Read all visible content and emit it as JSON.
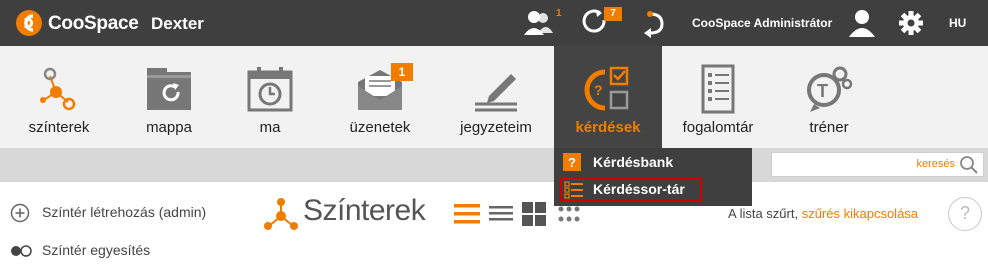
{
  "header": {
    "brand": "CooSpace",
    "course": "Dexter",
    "notif_users_count": "1",
    "notif_refresh_count": "7",
    "admin_label": "CooSpace Administrátor",
    "lang": "HU"
  },
  "modules": [
    {
      "label": "színterek",
      "icon": "scenes-icon"
    },
    {
      "label": "mappa",
      "icon": "folder-icon"
    },
    {
      "label": "ma",
      "icon": "calendar-icon"
    },
    {
      "label": "üzenetek",
      "icon": "envelope-icon",
      "badge": "1"
    },
    {
      "label": "jegyzeteim",
      "icon": "pencil-icon"
    },
    {
      "label": "kérdések",
      "icon": "questions-icon",
      "active": true
    },
    {
      "label": "fogalomtár",
      "icon": "glossary-icon"
    },
    {
      "label": "tréner",
      "icon": "trainer-icon"
    }
  ],
  "dropdown": {
    "items": [
      {
        "label": "Kérdésbank",
        "icon": "question-bank-icon"
      },
      {
        "label": "Kérdéssor-tár",
        "icon": "question-list-icon",
        "highlighted": true
      }
    ]
  },
  "search": {
    "placeholder": "keresés"
  },
  "sidebar": {
    "items": [
      {
        "label": "Színtér létrehozás (admin)",
        "icon": "plus-circle-icon"
      },
      {
        "label": "Színtér egyesítés",
        "icon": "toggle-icon"
      }
    ]
  },
  "main": {
    "title": "Színterek",
    "filter_text": "A lista szűrt,",
    "filter_link": "szűrés kikapcsolása",
    "help": "?"
  },
  "colors": {
    "accent": "#f07d00",
    "topbar": "#3f3f3f",
    "highlight_border": "#d00000"
  }
}
